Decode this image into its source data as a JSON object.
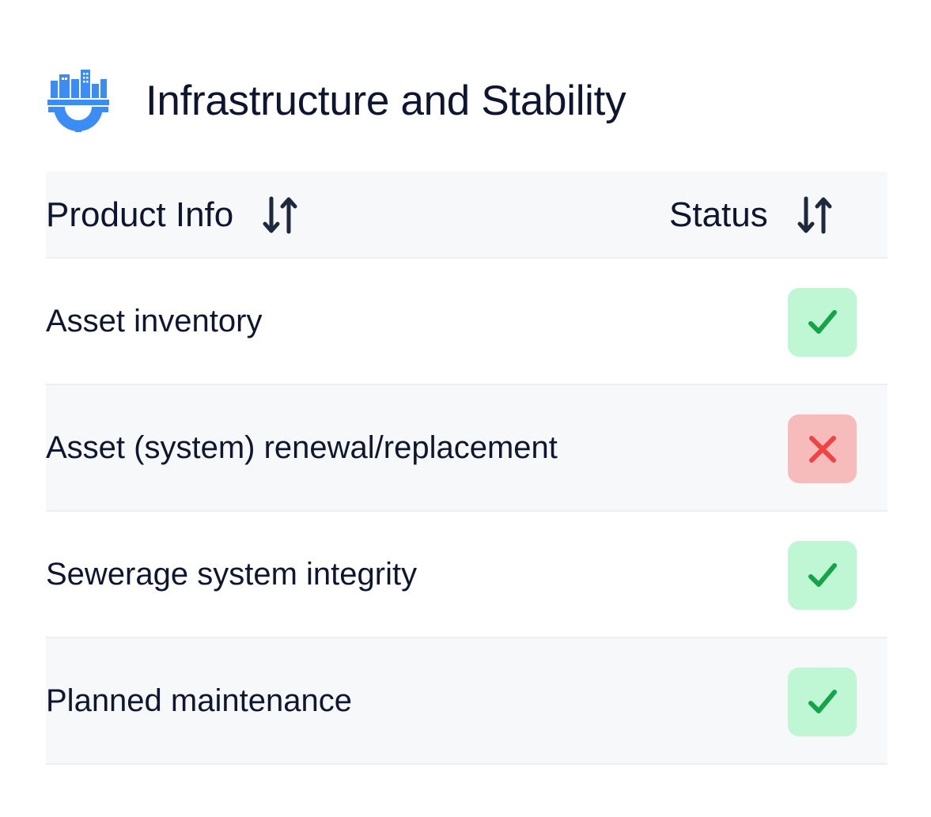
{
  "header": {
    "icon": "city-gear-icon",
    "title": "Infrastructure and Stability"
  },
  "table": {
    "columns": [
      {
        "label": "Product Info",
        "sort_icon": "sort-arrows-icon"
      },
      {
        "label": "Status",
        "sort_icon": "sort-arrows-icon"
      }
    ],
    "rows": [
      {
        "label": "Asset inventory",
        "status": "pass",
        "status_icon": "check-icon"
      },
      {
        "label": "Asset (system) renewal/replacement",
        "status": "fail",
        "status_icon": "x-icon"
      },
      {
        "label": "Sewerage system integrity",
        "status": "pass",
        "status_icon": "check-icon"
      },
      {
        "label": "Planned maintenance",
        "status": "pass",
        "status_icon": "check-icon"
      }
    ]
  },
  "colors": {
    "brand_blue": "#3b8df5",
    "pass_bg": "#bff7d4",
    "pass_fg": "#16a34a",
    "fail_bg": "#f6bcbc",
    "fail_fg": "#ef4444",
    "header_bg": "#f7f8fa",
    "text": "#0f1730"
  }
}
